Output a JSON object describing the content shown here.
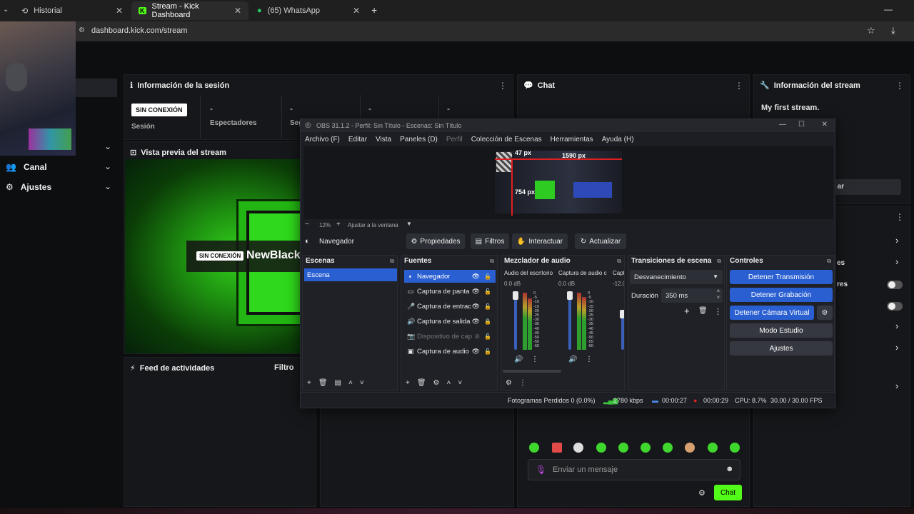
{
  "browser": {
    "tabs": [
      {
        "label": "Historial",
        "icon": "history-icon"
      },
      {
        "label": "Stream - Kick Dashboard",
        "icon": "kick-icon"
      },
      {
        "label": "(65) WhatsApp",
        "icon": "whatsapp-icon"
      }
    ],
    "new_tab": "+",
    "url": "dashboard.kick.com/stream"
  },
  "sidebar": {
    "items": [
      {
        "label": "Canal",
        "icon": "people-icon"
      },
      {
        "label": "Ajustes",
        "icon": "gear-icon"
      }
    ]
  },
  "session": {
    "title": "Información de la sesión",
    "status_badge": "SIN CONEXIÓN",
    "status_caption": "Sesión",
    "stat_values": [
      "-",
      "-",
      "-",
      "-"
    ],
    "stat_labels": [
      "Espectadores",
      "Seg"
    ]
  },
  "preview": {
    "title": "Vista previa del stream",
    "badge": "SIN CONEXIÓN",
    "channel_name": "NewBlack"
  },
  "activity": {
    "title": "Feed de actividades",
    "filter": "Filtro"
  },
  "chat": {
    "title": "Chat",
    "input_placeholder": "Enviar un mensaje",
    "send_label": "Chat"
  },
  "stream_info": {
    "title": "Información del stream",
    "stream_title": "My first stream.",
    "button_partial": "ar",
    "partial_label_1": "es",
    "partial_label_2": "res"
  },
  "obs": {
    "window_title": "OBS 31.1.2 - Perfil: Sin Título - Escenas: Sin Título",
    "menu": [
      "Archivo (F)",
      "Editar",
      "Vista",
      "Paneles (D)",
      "Perfil",
      "Colección de Escenas",
      "Herramientas",
      "Ayuda (H)"
    ],
    "preview_labels": {
      "w": "1590 px",
      "h": "754 px",
      "x": "47 px"
    },
    "zoom": "12%",
    "fit_label": "Ajustar a la ventana",
    "selected_source": "Navegador",
    "source_tools": [
      "Propiedades",
      "Filtros",
      "Interactuar",
      "Actualizar"
    ],
    "scenes": {
      "title": "Escenas",
      "items": [
        "Escena"
      ]
    },
    "sources": {
      "title": "Fuentes",
      "items": [
        "Navegador",
        "Captura de panta",
        "Captura de entrac",
        "Captura de salida",
        "Dispositivo de cap",
        "Captura de audio"
      ]
    },
    "mixer": {
      "title": "Mezclador de audio",
      "channels": [
        {
          "name": "Audio del escritorio",
          "db": "0.0 dB"
        },
        {
          "name": "Captura de audio c",
          "db": "0.0 dB"
        },
        {
          "name": "Capt",
          "db": "-12.0"
        }
      ],
      "scale": [
        "0",
        "-5",
        "-10",
        "-15",
        "-20",
        "-25",
        "-30",
        "-35",
        "-40",
        "-45",
        "-50",
        "-55",
        "-60"
      ]
    },
    "transitions": {
      "title": "Transiciones de escena",
      "selected": "Desvanecimiento",
      "duration_label": "Duración",
      "duration_value": "350 ms"
    },
    "controls": {
      "title": "Controles",
      "buttons": [
        "Detener Transmisión",
        "Detener Grabación",
        "Detener Cámara Virtual",
        "Modo Estudio",
        "Ajustes"
      ]
    },
    "status": {
      "dropped": "Fotogramas Perdidos 0 (0.0%)",
      "bitrate": "2780 kbps",
      "stream_time": "00:00:27",
      "rec_time": "00:00:29",
      "cpu": "CPU: 8.7%",
      "fps": "30.00 / 30.00 FPS"
    }
  },
  "colors": {
    "kick_green": "#53fc18",
    "obs_blue": "#2a5fd1",
    "rec_red": "#e02020"
  }
}
